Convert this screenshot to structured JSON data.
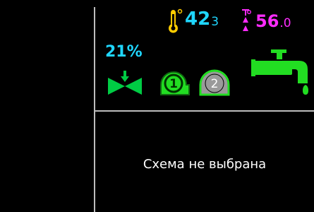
{
  "sensors": {
    "temperature": {
      "main": "42",
      "fraction": "3",
      "color": "#1fd6ff",
      "icon": "thermometer-icon"
    },
    "humidity": {
      "main": "56",
      "fraction": ".0",
      "color": "#ff2cff",
      "icon": "humidity-drop-icon"
    }
  },
  "valve": {
    "percent_label": "21%",
    "icon": "valve-icon",
    "color": "#1fd6ff"
  },
  "pumps": [
    {
      "label": "1",
      "state": "active",
      "color": "#22dd22"
    },
    {
      "label": "2",
      "state": "inactive",
      "color": "#9a9a9a"
    }
  ],
  "faucet": {
    "icon": "faucet-icon",
    "color": "#22dd22"
  },
  "status": {
    "message": "Схема не выбрана"
  }
}
